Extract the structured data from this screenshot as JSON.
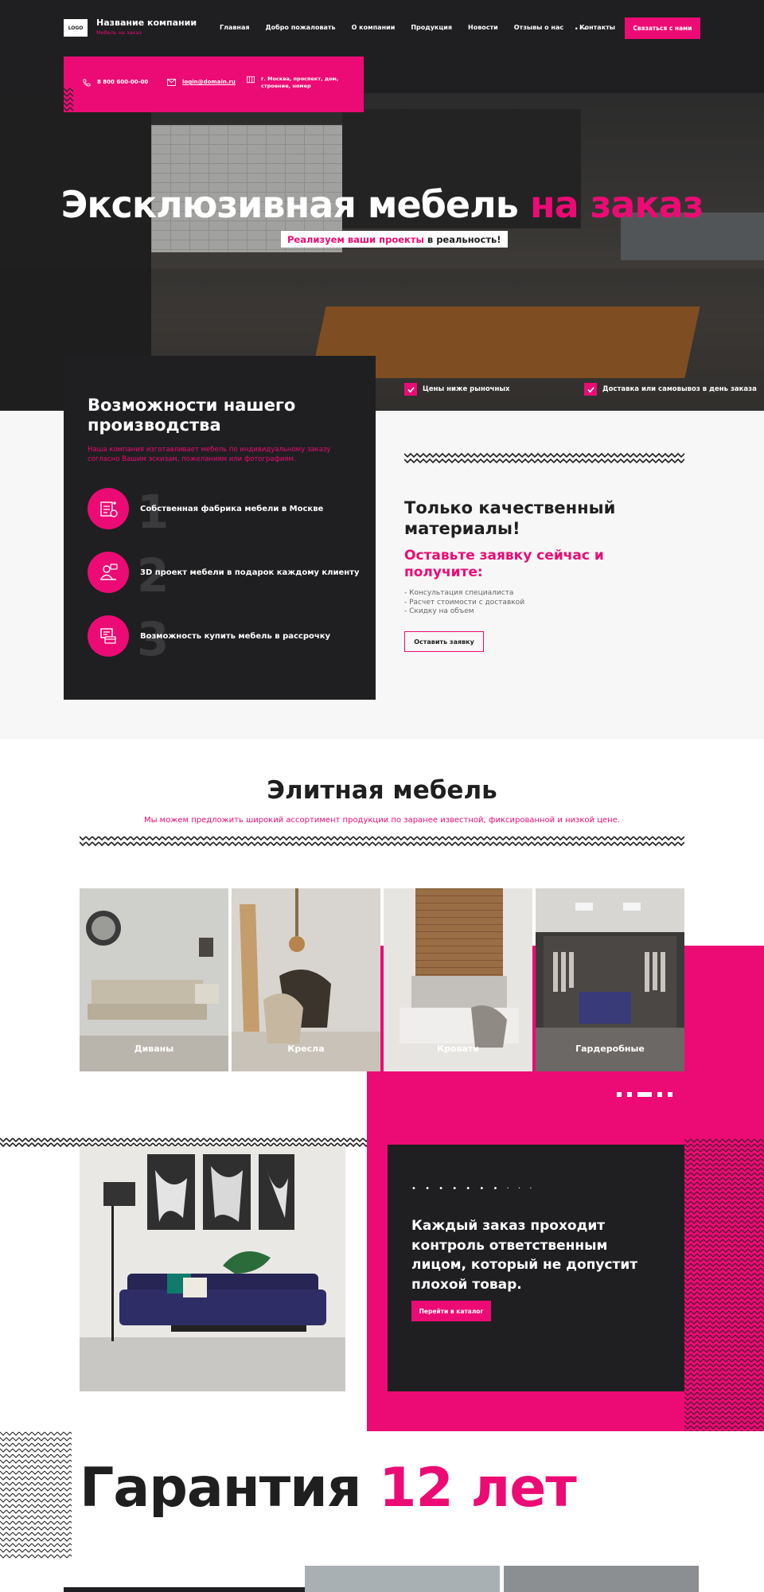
{
  "header": {
    "logo_text": "LOGO",
    "company_name": "Название компании",
    "company_tagline": "Мебель на заказ",
    "nav": [
      "Главная",
      "Добро пожаловать",
      "О компании",
      "Продукция",
      "Новости",
      "Отзывы о нас",
      "Контакты"
    ],
    "nav_more": "...",
    "contact_button": "Связаться с нами"
  },
  "contacts": {
    "phone": "8 800 600-00-00",
    "email": "login@domain.ru",
    "address_line1": "г. Москва, проспект, дом,",
    "address_line2": "строение, номер"
  },
  "hero": {
    "title_main": "Эксклюзивная мебель",
    "title_accent": "на заказ",
    "subtitle_accent": "Реализуем ваши проекты",
    "subtitle_rest": "в реальность!",
    "check1": "Цены ниже рыночных",
    "check2": "Доставка или самовывоз в день заказа"
  },
  "features": {
    "title": "Возможности нашего производства",
    "description": "Наша компания изготавливает мебель по индивидуальному заказу согласно Вашим эскизам, пожеланиям или фотографиям.",
    "items": [
      {
        "number": "1",
        "text": "Собственная фабрика мебели в Москве",
        "icon": "factory-icon"
      },
      {
        "number": "2",
        "text": "3D проект мебели в подарок каждому клиенту",
        "icon": "designer-icon"
      },
      {
        "number": "3",
        "text": "Возможность купить мебель в рассрочку",
        "icon": "payment-icon"
      }
    ]
  },
  "quality_offer": {
    "title": "Только качественный материалы!",
    "subtitle": "Оставьте заявку сейчас и получите:",
    "list": [
      "- Консультация специалиста",
      "- Расчет стоимости с доставкой",
      "- Скидку на объем"
    ],
    "button": "Оставить заявку"
  },
  "elite": {
    "title": "Элитная мебель",
    "subtitle": "Мы можем предложить широкий ассортимент продукции по заранее известной, фиксированной и низкой цене.",
    "categories": [
      "Диваны",
      "Кресла",
      "Кровати",
      "Гардеробные"
    ],
    "slider_pages": 5,
    "slider_active": 3
  },
  "control": {
    "dots": "• • • • • • • · · ·",
    "text": "Каждый заказ проходит контроль ответственным лицом, который не допустит плохой товар.",
    "button": "Перейти в каталог"
  },
  "guarantee": {
    "title_main": "Гарантия",
    "title_accent": "12 лет"
  },
  "colors": {
    "accent": "#ec0b74",
    "dark": "#1f1f21",
    "light_bg": "#f7f7f7"
  }
}
